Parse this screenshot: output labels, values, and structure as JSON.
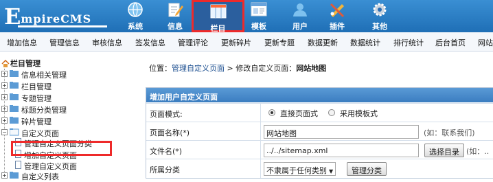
{
  "logo": {
    "big": "E",
    "rest": "mpireCMS"
  },
  "nav": [
    {
      "label": "系统",
      "icon": "globe-icon"
    },
    {
      "label": "信息",
      "icon": "edit-icon"
    },
    {
      "label": "栏目",
      "icon": "columns-icon"
    },
    {
      "label": "模板",
      "icon": "template-icon"
    },
    {
      "label": "用户",
      "icon": "user-icon"
    },
    {
      "label": "插件",
      "icon": "plugin-icon"
    },
    {
      "label": "其他",
      "icon": "gear-icon"
    }
  ],
  "menu": [
    "增加信息",
    "管理信息",
    "审核信息",
    "签发信息",
    "管理评论",
    "更新碎片",
    "更新专题",
    "数据更新",
    "数据统计",
    "排行统计",
    "后台首页",
    "网站"
  ],
  "tree": {
    "title": "栏目管理",
    "nodes": [
      "信息相关管理",
      "栏目管理",
      "专题管理",
      "标题分类管理",
      "碎片管理",
      "自定义页面",
      "管理自定义页面分类",
      "增加自定义页面",
      "管理自定义页面",
      "自定义列表"
    ]
  },
  "breadcrumb": {
    "prefix": "位置：",
    "link": "管理自定义页面",
    "sep": " > ",
    "mid": "修改自定义页面：",
    "current": "网站地图"
  },
  "form": {
    "title": "增加用户自定义页面",
    "mode_label": "页面模式:",
    "mode_opt1": "直接页面式",
    "mode_opt2": "采用模板式",
    "name_label": "页面名称(*)",
    "name_value": "网站地图",
    "name_hint": "(如：联系我们)",
    "file_label": "文件名(*)",
    "file_value": "../../sitemap.xml",
    "file_button": "选择目录",
    "file_hint": "(如：..",
    "cat_label": "所属分类",
    "cat_value": "不隶属于任何类别",
    "cat_button": "管理分类"
  }
}
